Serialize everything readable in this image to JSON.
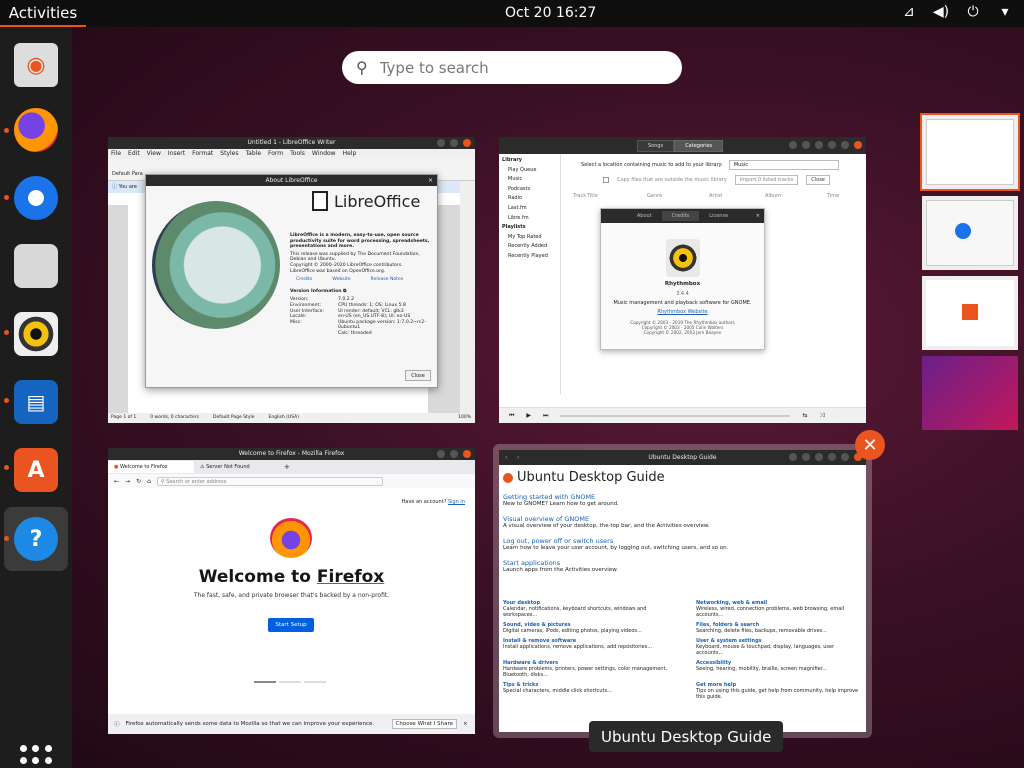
{
  "topbar": {
    "activities": "Activities",
    "clock": "Oct 20  16:27"
  },
  "search": {
    "placeholder": "Type to search"
  },
  "writer": {
    "title": "Untitled 1 - LibreOffice Writer",
    "menu": [
      "File",
      "Edit",
      "View",
      "Insert",
      "Format",
      "Styles",
      "Table",
      "Form",
      "Tools",
      "Window",
      "Help"
    ],
    "para_style": "Default Para",
    "infobar": "You are",
    "about_title": "About LibreOffice",
    "brand": "LibreOffice",
    "desc": "LibreOffice is a modern, easy-to-use, open source productivity suite for word processing, spreadsheets, presentations and more.",
    "supplied": "This release was supplied by The Document Foundation, Debian and Ubuntu.",
    "copyright": "Copyright © 2000–2020 LibreOffice contributors.",
    "based": "LibreOffice was based on OpenOffice.org.",
    "credits": "Credits",
    "website": "Website",
    "release_notes": "Release Notes",
    "version_info": "Version Information",
    "info_keys": "Version:\nEnvironment:\nUser Interface:\nLocale:\nMisc:",
    "info_vals": "7.0.2.2\nCPU threads: 1; OS: Linux 5.8\nUI render: default; VCL: gtk3\nen-US (en_US.UTF-8); UI: en-US\nUbuntu package version: 1:7.0.2~rc2-0ubuntu1\nCalc: threaded",
    "close": "Close",
    "status_page": "Page 1 of 1",
    "status_words": "0 words, 0 characters",
    "status_style": "Default Page Style",
    "status_lang": "English (USA)",
    "zoom": "100%"
  },
  "rhythmbox": {
    "tab_songs": "Songs",
    "tab_categories": "Categories",
    "library": "Library",
    "library_items": [
      "Play Queue",
      "Music",
      "Podcasts",
      "Radio",
      "Last.fm",
      "Libre.fm"
    ],
    "playlists": "Playlists",
    "playlist_items": [
      "My Top Rated",
      "Recently Added",
      "Recently Played"
    ],
    "location_label": "Select a location containing music to add to your library:",
    "location_value": "Music",
    "copy_files": "Copy files that are outside the music library",
    "import_btn": "Import 0 listed tracks",
    "close_btn": "Close",
    "columns": [
      "Track",
      "Title",
      "Genre",
      "Artist",
      "Album",
      "Time"
    ],
    "about_tabs": [
      "About",
      "Credits",
      "License"
    ],
    "app_name": "Rhythmbox",
    "version": "3.4.4",
    "app_desc": "Music management and playback software for GNOME.",
    "app_link": "Rhythmbox Website",
    "copy1": "Copyright © 2003 - 2019 The Rhythmbox authors",
    "copy2": "Copyright © 2003 - 2005 Colin Walters",
    "copy3": "Copyright © 2002, 2003 Jorn Baayen"
  },
  "firefox": {
    "title": "Welcome to Firefox - Mozilla Firefox",
    "tab1": "Welcome to Firefox",
    "tab2": "Server Not Found",
    "url_placeholder": "Search or enter address",
    "account": "Have an account?",
    "signin": "Sign in",
    "welcome": "Welcome to ",
    "welcome_brand": "Firefox",
    "tagline": "The fast, safe, and private browser that's backed by a non-profit.",
    "start": "Start Setup",
    "notice": "Firefox automatically sends some data to Mozilla so that we can improve your experience.",
    "choose": "Choose What I Share"
  },
  "help": {
    "title": "Ubuntu Desktop Guide",
    "heading": "Ubuntu Desktop Guide",
    "topics": [
      {
        "t": "Getting started with GNOME",
        "d": "New to GNOME? Learn how to get around."
      },
      {
        "t": "Visual overview of GNOME",
        "d": "A visual overview of your desktop, the top bar, and the Activities overview."
      },
      {
        "t": "Log out, power off or switch users",
        "d": "Learn how to leave your user account, by logging out, switching users, and so on."
      },
      {
        "t": "Start applications",
        "d": "Launch apps from the Activities overview."
      }
    ],
    "grid": [
      {
        "t": "Your desktop",
        "d": "Calendar, notifications, keyboard shortcuts, windows and workspaces..."
      },
      {
        "t": "Networking, web & email",
        "d": "Wireless, wired, connection problems, web browsing, email accounts..."
      },
      {
        "t": "Sound, video & pictures",
        "d": "Digital cameras, iPods, editing photos, playing videos..."
      },
      {
        "t": "Files, folders & search",
        "d": "Searching, delete files, backups, removable drives..."
      },
      {
        "t": "Install & remove software",
        "d": "Install applications, remove applications, add repositories..."
      },
      {
        "t": "User & system settings",
        "d": "Keyboard, mouse & touchpad, display, languages, user accounts..."
      },
      {
        "t": "Hardware & drivers",
        "d": "Hardware problems, printers, power settings, color management, Bluetooth, disks..."
      },
      {
        "t": "Accessibility",
        "d": "Seeing, hearing, mobility, braille, screen magnifier..."
      },
      {
        "t": "Tips & tricks",
        "d": "Special characters, middle click shortcuts..."
      },
      {
        "t": "Get more help",
        "d": "Tips on using this guide, get help from community, help improve this guide."
      }
    ]
  },
  "caption": "Ubuntu Desktop Guide",
  "colors": {
    "accent": "#e95420",
    "link": "#1a5fb4",
    "topbar": "#0f0f0f",
    "dock": "#1d1d1d"
  }
}
